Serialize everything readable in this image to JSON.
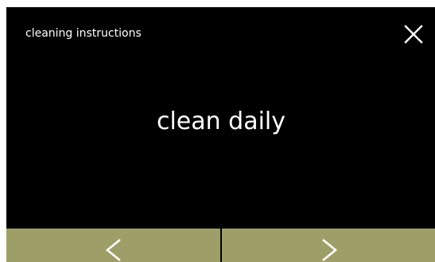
{
  "header": {
    "title": "cleaning instructions",
    "close_icon": "close-icon"
  },
  "main": {
    "message": "clean daily"
  },
  "nav": {
    "prev_icon": "chevron-left-icon",
    "next_icon": "chevron-right-icon"
  },
  "colors": {
    "background": "#000000",
    "text": "#ffffff",
    "nav_button": "#9e9f68"
  }
}
